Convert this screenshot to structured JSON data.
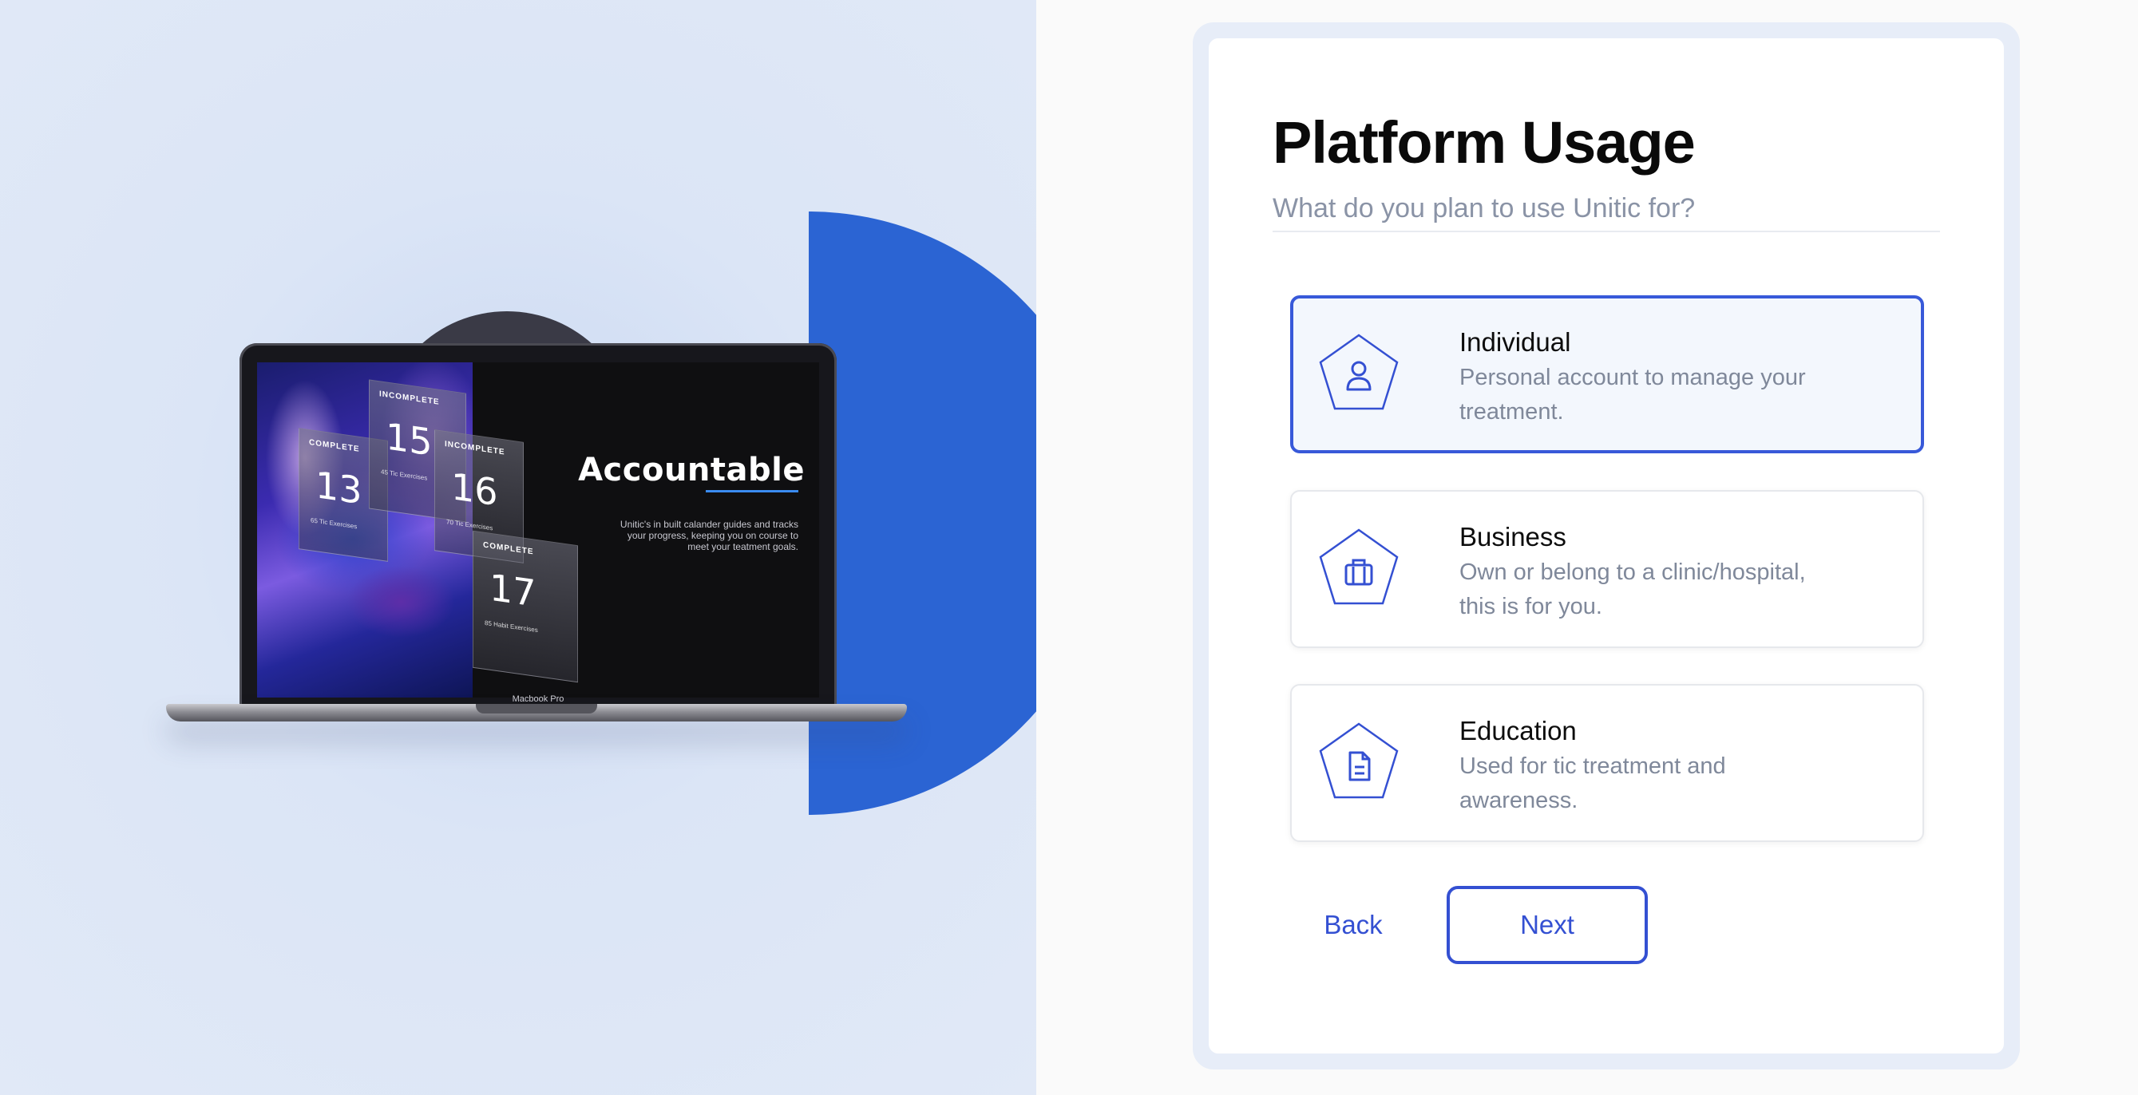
{
  "showcase": {
    "headline": "Accountable",
    "blurb": "Unitic's in built calander guides and tracks your progress, keeping you on course to meet your teatment goals.",
    "device_label": "Macbook Pro",
    "stats": [
      {
        "label": "COMPLETE",
        "value": "13",
        "sub": "65 Tic Exercises"
      },
      {
        "label": "INCOMPLETE",
        "value": "15",
        "sub": "45 Tic Exercises"
      },
      {
        "label": "INCOMPLETE",
        "value": "16",
        "sub": "70 Tic Exercises"
      },
      {
        "label": "COMPLETE",
        "value": "17",
        "sub": "85 Habit Exercises"
      }
    ]
  },
  "form": {
    "title": "Platform Usage",
    "subtitle": "What do you plan to use Unitic for?",
    "options": [
      {
        "title": "Individual",
        "description": "Personal account to manage your treatment.",
        "icon": "user-icon",
        "selected": true
      },
      {
        "title": "Business",
        "description": "Own or belong to a clinic/hospital, this is for you.",
        "icon": "briefcase-icon",
        "selected": false
      },
      {
        "title": "Education",
        "description": "Used for tic treatment and awareness.",
        "icon": "document-icon",
        "selected": false
      }
    ],
    "back_label": "Back",
    "next_label": "Next"
  },
  "colors": {
    "accent": "#3450d2",
    "brand_blue": "#2b64d3",
    "muted_text": "#7f889a",
    "selected_bg": "#f3f7fd"
  }
}
